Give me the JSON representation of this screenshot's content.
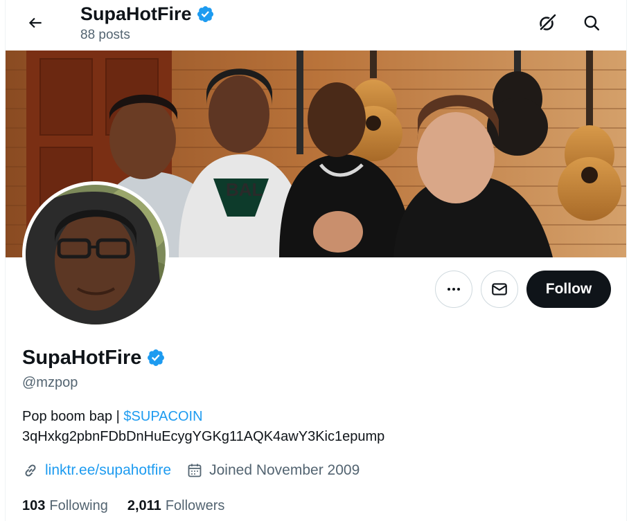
{
  "header": {
    "name": "SupaHotFire",
    "posts": "88 posts"
  },
  "profile": {
    "name": "SupaHotFire",
    "handle": "@mzpop",
    "bio_text": "Pop boom bap | ",
    "bio_link": "$SUPACOIN",
    "bio_line2": "3qHxkg2pbnFDbDnHuEcygYGKg11AQK4awY3Kic1epump",
    "website": "linktr.ee/supahotfire",
    "joined": "Joined November 2009",
    "following_count": "103",
    "following_label": "Following",
    "followers_count": "2,011",
    "followers_label": "Followers"
  },
  "actions": {
    "follow_label": "Follow"
  },
  "icons": {
    "back": "arrow-left-icon",
    "grok": "grok-icon",
    "search": "search-icon",
    "more": "more-horizontal-icon",
    "message": "envelope-icon",
    "verified": "verified-badge-icon",
    "link": "link-icon",
    "calendar": "calendar-icon"
  },
  "colors": {
    "accent": "#1d9bf0",
    "text": "#0f1419",
    "secondary": "#536471",
    "follow_bg": "#0f1419"
  }
}
